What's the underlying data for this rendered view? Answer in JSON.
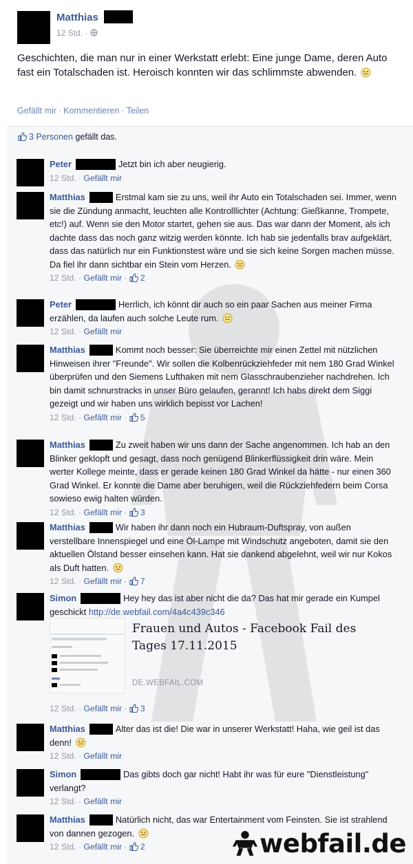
{
  "post": {
    "author": "Matthias",
    "time": "12 Std.",
    "meta_separator": "·",
    "text": "Geschichten, die man nur in einer Werkstatt erlebt: Eine junge Dame, deren Auto fast ein Totalschaden ist. Heroisch konnten wir das schlimmste abwenden.",
    "actions": {
      "like": "Gefällt mir",
      "comment": "Kommentieren",
      "share": "Teilen",
      "separator": "·"
    }
  },
  "likes": {
    "count_link": "3 Personen",
    "suffix": "gefällt das."
  },
  "comments": [
    {
      "author": "Peter",
      "text": "Jetzt bin ich aber neugierig.",
      "time": "12 Std.",
      "like_label": "Gefällt mir",
      "likes": ""
    },
    {
      "author": "Matthias",
      "text": "Erstmal kam sie zu uns, weil ihr Auto ein Totalschaden sei. Immer, wenn sie die Zündung anmacht, leuchten alle Kontrolllichter (Achtung: Gießkanne, Trompete, etc!) auf. Wenn sie den Motor startet, gehen sie aus. Das war dann der Moment, als ich dachte dass das noch ganz witzig werden könnte. Ich hab sie jedenfalls brav aufgeklärt, dass das natürlich nur ein Funktionstest wäre und sie sich keine Sorgen machen müsse. Da fiel ihr dann sichtbar ein Stein vom Herzen.",
      "time": "12 Std.",
      "like_label": "Gefällt mir",
      "likes": "2"
    },
    {
      "author": "Peter",
      "text": "Herrlich, ich könnt dir auch so ein paar Sachen aus meiner Firma erzählen, da laufen auch solche Leute rum.",
      "time": "12 Std.",
      "like_label": "Gefällt mir",
      "likes": ""
    },
    {
      "author": "Matthias",
      "text": "Kommt noch besser: Sie überreichte mir einen Zettel mit nützlichen Hinweisen ihrer \"Freunde\". Wir sollen die Kolbenrückziehfeder mit nem 180 Grad Winkel überprüfen und den Siemens Lufthaken mit nem Glasschraubenzieher nachdrehen. Ich bin damit schnurstracks in unser Büro gelaufen, gerannt! Ich habs direkt dem Siggi gezeigt und wir haben uns wirklich bepisst vor Lachen!",
      "time": "12 Std.",
      "like_label": "Gefällt mir",
      "likes": "5"
    },
    {
      "author": "Matthias",
      "text": "Zu zweit haben wir uns dann der Sache angenommen. Ich hab an den Blinker geklopft und gesagt, dass noch genügend Blinkerflüssigkeit drin wäre. Mein werter Kollege meinte, dass er gerade keinen 180 Grad Winkel da hätte - nur einen 360 Grad Winkel. Er konnte die Dame aber beruhigen, weil die Rückziehfedern beim Corsa sowieso ewig halten würden.",
      "time": "12 Std.",
      "like_label": "Gefällt mir",
      "likes": "3"
    },
    {
      "author": "Matthias",
      "text": "Wir haben ihr dann noch ein Hubraum-Duftspray, von außen verstellbare Innenspiegel und eine Öl-Lampe mit Windschutz angeboten, damit sie den aktuellen Ölstand besser einsehen kann. Hat sie dankend abgelehnt, weil wir nur Kokos als Duft hatten.",
      "time": "12 Std.",
      "like_label": "Gefällt mir",
      "likes": "7"
    },
    {
      "author": "Simon",
      "text": "Hey hey das ist aber nicht die da? Das hat mir gerade ein Kumpel geschickt",
      "url": "http://de.webfail.com/4a4c439c346",
      "share": {
        "title": "Frauen und Autos - Facebook Fail des Tages 17.11.2015",
        "domain": "DE.WEBFAIL.COM"
      },
      "time": "12 Std.",
      "like_label": "Gefällt mir",
      "likes": "3"
    },
    {
      "author": "Matthias",
      "text": "Alter das ist die! Die war in unserer Werkstatt! Haha, wie geil ist das denn!",
      "time": "12 Std.",
      "like_label": "Gefällt mir",
      "likes": ""
    },
    {
      "author": "Simon",
      "text": "Das gibts doch gar nicht! Habt ihr was für eure \"Dienstleistung\" verlangt?",
      "time": "12 Std.",
      "like_label": "Gefällt mir",
      "likes": ""
    },
    {
      "author": "Matthias",
      "text": "Natürlich nicht, das war Entertainment vom Feinsten. Sie ist strahlend von dannen gezogen.",
      "time": "12 Std.",
      "like_label": "Gefällt mir",
      "likes": "2"
    }
  ],
  "brand": "webfail.de",
  "colors": {
    "link": "#3b5998",
    "meta": "#9197a3",
    "comments_bg": "#f6f7f9"
  }
}
